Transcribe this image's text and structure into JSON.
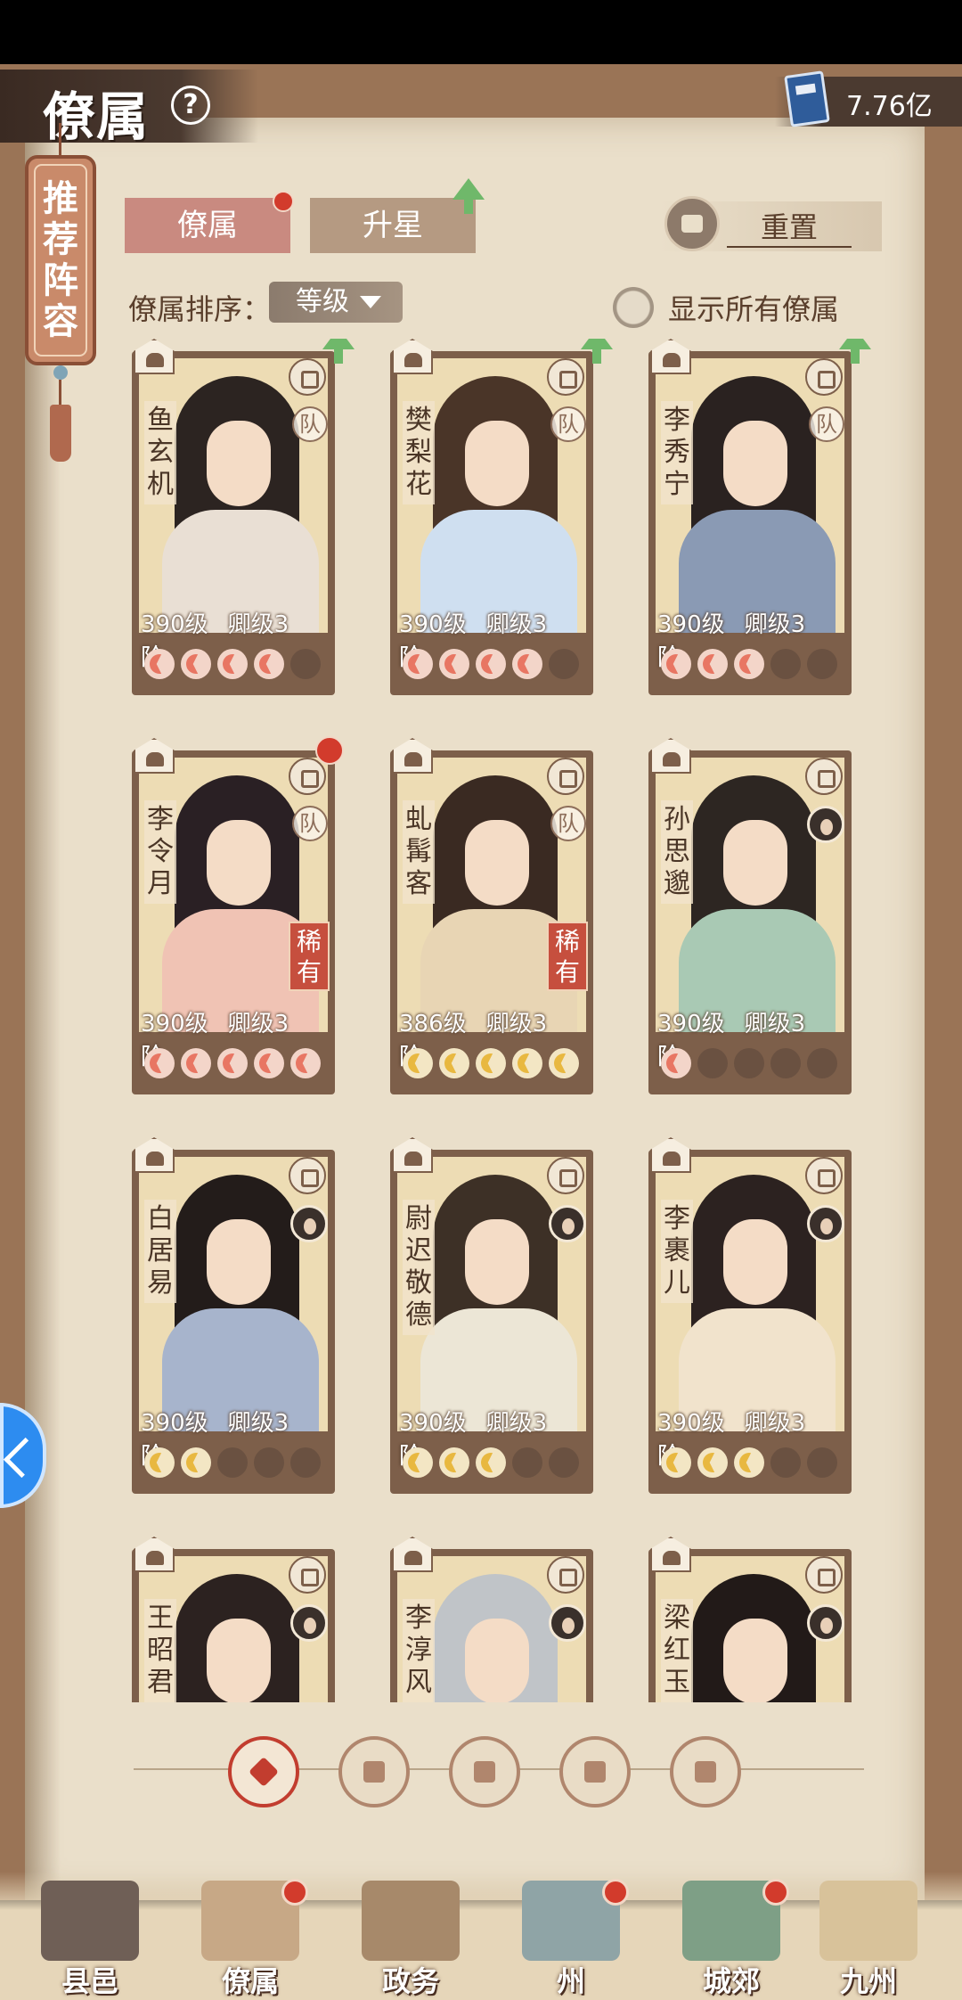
{
  "header": {
    "title": "僚属",
    "help_icon": "question-icon",
    "currency_value": "7.76亿",
    "currency_icon": "blue-book-icon"
  },
  "recommend": {
    "label": "推荐阵容"
  },
  "tabs": [
    {
      "label": "僚属"
    },
    {
      "label": "升星"
    }
  ],
  "reset": {
    "label": "重置"
  },
  "sort": {
    "label": "僚属排序：",
    "value": "等级"
  },
  "show_all": {
    "label": "显示所有僚属"
  },
  "cards": [
    {
      "name": "鱼玄机",
      "level": "390级",
      "rank": "卿级3阶",
      "team": "队",
      "stars_on": 4,
      "star_color": "red",
      "upgrade": true
    },
    {
      "name": "樊梨花",
      "level": "390级",
      "rank": "卿级3阶",
      "team": "队",
      "stars_on": 4,
      "star_color": "red",
      "upgrade": true
    },
    {
      "name": "李秀宁",
      "level": "390级",
      "rank": "卿级3阶",
      "team": "队",
      "stars_on": 3,
      "star_color": "red",
      "upgrade": true
    },
    {
      "name": "李令月",
      "level": "390级",
      "rank": "卿级3阶",
      "team": "队",
      "rare": "稀有",
      "stars_on": 5,
      "star_color": "red",
      "new": true
    },
    {
      "name": "虬髯客",
      "level": "386级",
      "rank": "卿级3阶",
      "team": "队",
      "rare": "稀有",
      "stars_on": 5,
      "star_color": "gold"
    },
    {
      "name": "孙思邈",
      "level": "390级",
      "rank": "卿级3阶",
      "stars_on": 1,
      "star_color": "red"
    },
    {
      "name": "白居易",
      "level": "390级",
      "rank": "卿级3阶",
      "stars_on": 2,
      "star_color": "gold"
    },
    {
      "name": "尉迟敬德",
      "level": "390级",
      "rank": "卿级3阶",
      "stars_on": 3,
      "star_color": "gold"
    },
    {
      "name": "李裹儿",
      "level": "390级",
      "rank": "卿级3阶",
      "stars_on": 3,
      "star_color": "gold"
    },
    {
      "name": "王昭君"
    },
    {
      "name": "李淳风"
    },
    {
      "name": "梁红玉"
    }
  ],
  "filters": [
    "all-filter-icon",
    "civil-filter-icon",
    "cat-filter-icon",
    "fan-filter-icon",
    "beast-filter-icon"
  ],
  "nav": [
    {
      "label": "县邑",
      "icon": "town-gate-icon"
    },
    {
      "label": "僚属",
      "icon": "scroll-icon",
      "badge": true
    },
    {
      "label": "政务",
      "icon": "documents-icon"
    },
    {
      "label": "州",
      "icon": "mountain-icon",
      "badge": true
    },
    {
      "label": "城郊",
      "icon": "suburb-icon",
      "badge": true
    },
    {
      "label": "九州",
      "icon": "map-scroll-icon"
    }
  ],
  "colors": {
    "accent_red": "#d23b2c",
    "tab_active": "#c98a80",
    "paper": "#eadfca",
    "frame": "#7d5f4a"
  }
}
